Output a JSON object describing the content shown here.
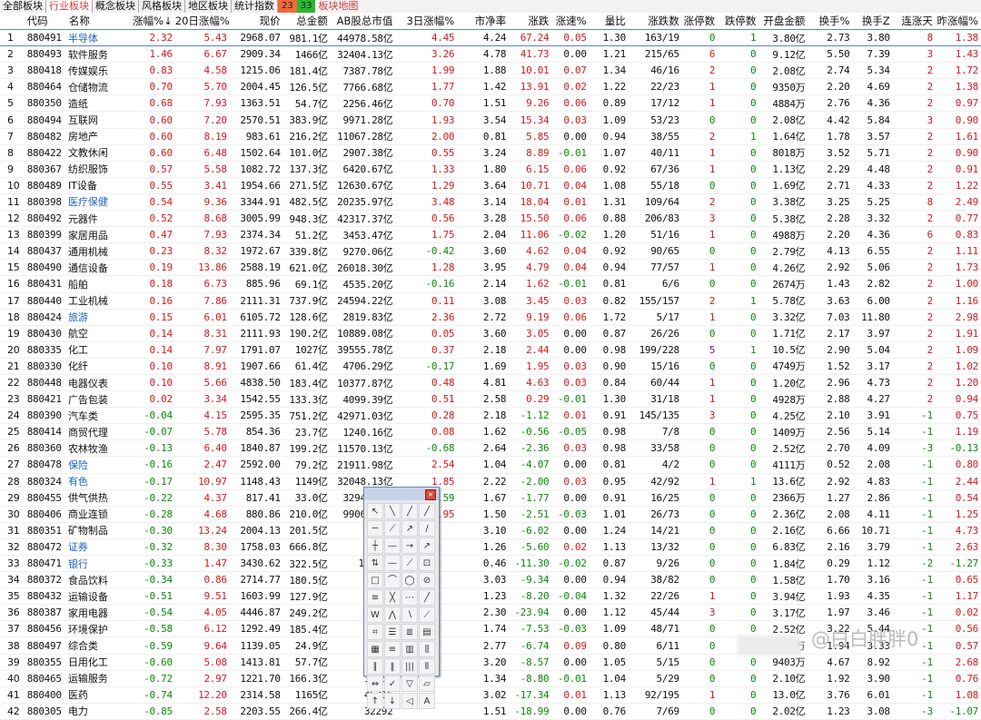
{
  "tabs": [
    {
      "label": "全部板块",
      "active": false
    },
    {
      "label": "行业板块",
      "active": true
    },
    {
      "label": "概念板块",
      "active": false
    },
    {
      "label": "风格板块",
      "active": false
    },
    {
      "label": "地区板块",
      "active": false
    },
    {
      "label": "统计指数",
      "active": false
    }
  ],
  "up_count": "23",
  "down_count": "33",
  "map_label": "板块地图",
  "headers": [
    "",
    "代码",
    "名称",
    "涨幅%↓",
    "20日涨幅%",
    "现价",
    "总金额",
    "AB股总市值",
    "3日涨幅%",
    "市净率",
    "涨跌",
    "涨速%",
    "量比",
    "涨跌数",
    "涨停数",
    "跌停数",
    "开盘金额",
    "换手%",
    "换手Z",
    "连涨天",
    "昨涨幅%"
  ],
  "rows": [
    [
      "1",
      "880491",
      "半导体",
      "2.32",
      "5.43",
      "2968.07",
      "981.1亿",
      "44978.58亿",
      "4.45",
      "4.24",
      "67.24",
      "0.05",
      "1.30",
      "163/19",
      "0",
      "1",
      "3.80亿",
      "2.73",
      "3.80",
      "8",
      "1.38"
    ],
    [
      "2",
      "880493",
      "软件服务",
      "1.46",
      "6.67",
      "2909.34",
      "1466亿",
      "32404.13亿",
      "3.26",
      "4.78",
      "41.73",
      "0.00",
      "1.21",
      "215/65",
      "6",
      "0",
      "9.12亿",
      "5.50",
      "7.39",
      "3",
      "1.43"
    ],
    [
      "3",
      "880418",
      "传媒娱乐",
      "0.83",
      "4.58",
      "1215.06",
      "181.4亿",
      "7387.78亿",
      "1.99",
      "1.88",
      "10.01",
      "0.07",
      "1.34",
      "46/16",
      "2",
      "0",
      "2.08亿",
      "2.74",
      "5.34",
      "2",
      "1.72"
    ],
    [
      "4",
      "880464",
      "仓储物流",
      "0.70",
      "5.70",
      "2004.45",
      "126.5亿",
      "7766.68亿",
      "1.77",
      "1.42",
      "13.91",
      "0.02",
      "1.22",
      "22/23",
      "1",
      "0",
      "9350万",
      "2.20",
      "4.69",
      "2",
      "1.38"
    ],
    [
      "5",
      "880350",
      "造纸",
      "0.68",
      "7.93",
      "1363.51",
      "54.7亿",
      "2256.46亿",
      "0.70",
      "1.51",
      "9.26",
      "0.06",
      "0.89",
      "17/12",
      "1",
      "0",
      "4884万",
      "2.76",
      "4.36",
      "2",
      "0.97"
    ],
    [
      "6",
      "880494",
      "互联网",
      "0.60",
      "7.20",
      "2570.51",
      "383.9亿",
      "9971.28亿",
      "1.93",
      "3.54",
      "15.34",
      "0.03",
      "1.09",
      "53/23",
      "0",
      "0",
      "2.08亿",
      "4.42",
      "5.84",
      "3",
      "0.90"
    ],
    [
      "7",
      "880482",
      "房地产",
      "0.60",
      "8.19",
      "983.61",
      "216.2亿",
      "11067.28亿",
      "2.00",
      "0.81",
      "5.85",
      "0.00",
      "0.94",
      "38/55",
      "2",
      "1",
      "1.64亿",
      "1.78",
      "3.57",
      "2",
      "1.61"
    ],
    [
      "8",
      "880422",
      "文教休闲",
      "0.60",
      "6.48",
      "1502.64",
      "101.0亿",
      "2907.38亿",
      "0.55",
      "3.24",
      "8.89",
      "-0.01",
      "1.07",
      "40/11",
      "1",
      "0",
      "8018万",
      "3.52",
      "5.71",
      "2",
      "0.90"
    ],
    [
      "9",
      "880367",
      "纺织服饰",
      "0.57",
      "5.58",
      "1082.72",
      "137.3亿",
      "6420.67亿",
      "1.33",
      "1.80",
      "6.15",
      "0.06",
      "0.92",
      "67/36",
      "1",
      "0",
      "1.13亿",
      "2.29",
      "4.48",
      "2",
      "0.91"
    ],
    [
      "10",
      "880489",
      "IT设备",
      "0.55",
      "3.41",
      "1954.66",
      "271.5亿",
      "12630.67亿",
      "1.29",
      "3.64",
      "10.71",
      "0.04",
      "1.08",
      "55/18",
      "0",
      "0",
      "1.69亿",
      "2.71",
      "4.33",
      "2",
      "1.22"
    ],
    [
      "11",
      "880398",
      "医疗保健",
      "0.54",
      "9.36",
      "3344.91",
      "482.5亿",
      "20235.97亿",
      "3.48",
      "3.14",
      "18.04",
      "0.01",
      "1.31",
      "109/64",
      "2",
      "0",
      "3.38亿",
      "3.25",
      "5.25",
      "8",
      "2.49"
    ],
    [
      "12",
      "880492",
      "元器件",
      "0.52",
      "8.68",
      "3005.99",
      "948.3亿",
      "42317.37亿",
      "0.56",
      "3.28",
      "15.50",
      "0.06",
      "0.88",
      "206/83",
      "3",
      "0",
      "5.38亿",
      "2.28",
      "3.32",
      "2",
      "0.77"
    ],
    [
      "13",
      "880399",
      "家居用品",
      "0.47",
      "7.93",
      "2374.34",
      "51.2亿",
      "3453.47亿",
      "1.75",
      "2.04",
      "11.06",
      "-0.02",
      "1.20",
      "51/16",
      "1",
      "0",
      "4988万",
      "2.20",
      "4.36",
      "6",
      "0.83"
    ],
    [
      "14",
      "880437",
      "通用机械",
      "0.23",
      "8.32",
      "1972.67",
      "339.8亿",
      "9270.06亿",
      "-0.42",
      "3.60",
      "4.62",
      "0.04",
      "0.92",
      "90/65",
      "0",
      "0",
      "2.79亿",
      "4.13",
      "6.55",
      "2",
      "1.11"
    ],
    [
      "15",
      "880490",
      "通信设备",
      "0.19",
      "13.86",
      "2588.19",
      "621.0亿",
      "26018.30亿",
      "1.28",
      "3.95",
      "4.79",
      "0.04",
      "0.94",
      "77/57",
      "1",
      "0",
      "4.26亿",
      "2.92",
      "5.06",
      "2",
      "1.73"
    ],
    [
      "16",
      "880431",
      "船舶",
      "0.18",
      "6.73",
      "885.96",
      "69.1亿",
      "4535.20亿",
      "-0.16",
      "2.14",
      "1.62",
      "-0.01",
      "0.81",
      "6/6",
      "0",
      "0",
      "2674万",
      "1.43",
      "2.82",
      "2",
      "1.00"
    ],
    [
      "17",
      "880440",
      "工业机械",
      "0.16",
      "7.86",
      "2111.31",
      "737.9亿",
      "24594.22亿",
      "0.11",
      "3.08",
      "3.45",
      "0.03",
      "0.82",
      "155/157",
      "2",
      "1",
      "5.78亿",
      "3.63",
      "6.00",
      "2",
      "1.16"
    ],
    [
      "18",
      "880424",
      "旅游",
      "0.15",
      "6.01",
      "6105.72",
      "128.6亿",
      "2819.83亿",
      "2.36",
      "2.72",
      "9.19",
      "0.06",
      "1.72",
      "5/17",
      "1",
      "0",
      "3.32亿",
      "7.03",
      "11.80",
      "2",
      "2.98"
    ],
    [
      "19",
      "880430",
      "航空",
      "0.14",
      "8.31",
      "2111.93",
      "190.2亿",
      "10889.08亿",
      "0.05",
      "3.60",
      "3.05",
      "0.00",
      "0.87",
      "26/26",
      "0",
      "0",
      "1.71亿",
      "2.17",
      "3.97",
      "2",
      "1.91"
    ],
    [
      "20",
      "880335",
      "化工",
      "0.14",
      "7.97",
      "1791.07",
      "1027亿",
      "39555.78亿",
      "0.37",
      "2.18",
      "2.44",
      "0.00",
      "0.98",
      "199/228",
      "5",
      "1",
      "10.5亿",
      "2.90",
      "5.04",
      "2",
      "1.09"
    ],
    [
      "21",
      "880330",
      "化纤",
      "0.10",
      "8.91",
      "1907.66",
      "61.4亿",
      "4706.29亿",
      "-0.17",
      "1.69",
      "1.95",
      "0.03",
      "0.90",
      "15/16",
      "0",
      "0",
      "4749万",
      "1.52",
      "3.17",
      "2",
      "1.02"
    ],
    [
      "22",
      "880448",
      "电器仪表",
      "0.10",
      "5.66",
      "4838.50",
      "183.4亿",
      "10377.87亿",
      "0.48",
      "4.81",
      "4.63",
      "0.03",
      "0.84",
      "60/44",
      "1",
      "0",
      "1.20亿",
      "2.96",
      "4.73",
      "2",
      "1.20"
    ],
    [
      "23",
      "880421",
      "广告包装",
      "0.02",
      "3.34",
      "1542.55",
      "133.3亿",
      "4099.39亿",
      "0.51",
      "2.58",
      "0.29",
      "-0.01",
      "1.30",
      "31/18",
      "1",
      "0",
      "4928万",
      "2.88",
      "4.27",
      "2",
      "0.94"
    ],
    [
      "24",
      "880390",
      "汽车类",
      "-0.04",
      "4.15",
      "2595.35",
      "751.2亿",
      "42971.03亿",
      "0.28",
      "2.18",
      "-1.12",
      "0.01",
      "0.91",
      "145/135",
      "3",
      "0",
      "4.25亿",
      "2.10",
      "3.91",
      "-1",
      "0.75"
    ],
    [
      "25",
      "880414",
      "商贸代理",
      "-0.07",
      "5.78",
      "854.36",
      "23.7亿",
      "1240.16亿",
      "0.08",
      "1.62",
      "-0.56",
      "-0.05",
      "0.98",
      "7/8",
      "0",
      "0",
      "1409万",
      "2.56",
      "5.14",
      "-1",
      "1.19"
    ],
    [
      "26",
      "880360",
      "农林牧渔",
      "-0.13",
      "6.40",
      "1840.87",
      "199.2亿",
      "11570.13亿",
      "-0.68",
      "2.64",
      "-2.36",
      "0.03",
      "0.98",
      "33/58",
      "0",
      "0",
      "2.52亿",
      "2.70",
      "4.09",
      "-3",
      "-0.13"
    ],
    [
      "27",
      "880478",
      "保险",
      "-0.16",
      "2.47",
      "2592.00",
      "79.2亿",
      "21911.98亿",
      "2.54",
      "1.04",
      "-4.07",
      "0.00",
      "0.81",
      "4/2",
      "0",
      "0",
      "4111万",
      "0.52",
      "2.08",
      "-1",
      "0.80"
    ],
    [
      "28",
      "880324",
      "有色",
      "-0.17",
      "10.97",
      "1148.43",
      "1149亿",
      "32048.13亿",
      "1.85",
      "2.22",
      "-2.00",
      "0.03",
      "0.95",
      "42/92",
      "1",
      "1",
      "13.6亿",
      "2.92",
      "4.83",
      "-1",
      "2.44"
    ],
    [
      "29",
      "880455",
      "供气供热",
      "-0.22",
      "4.37",
      "817.41",
      "33.0亿",
      "3294.26亿",
      "-0.59",
      "1.67",
      "-1.77",
      "0.00",
      "0.91",
      "16/25",
      "0",
      "0",
      "2366万",
      "1.27",
      "2.86",
      "-1",
      "0.54"
    ],
    [
      "30",
      "880406",
      "商业连锁",
      "-0.28",
      "4.68",
      "880.86",
      "210.0亿",
      "9906.76亿",
      "0.95",
      "1.50",
      "-2.51",
      "-0.03",
      "1.01",
      "26/73",
      "0",
      "0",
      "2.36亿",
      "2.08",
      "4.11",
      "-1",
      "1.25"
    ],
    [
      "31",
      "880351",
      "矿物制品",
      "-0.30",
      "13.24",
      "2004.13",
      "201.5亿",
      "3281",
      "",
      "3.10",
      "-6.02",
      "0.00",
      "1.24",
      "14/21",
      "0",
      "0",
      "2.16亿",
      "6.66",
      "10.71",
      "-1",
      "4.73"
    ],
    [
      "32",
      "880472",
      "证券",
      "-0.32",
      "8.30",
      "1758.03",
      "666.8亿",
      "36259",
      "",
      "1.26",
      "-5.60",
      "0.02",
      "1.13",
      "13/32",
      "0",
      "0",
      "6.83亿",
      "2.16",
      "3.79",
      "-1",
      "2.63"
    ],
    [
      "33",
      "880471",
      "银行",
      "-0.33",
      "1.47",
      "3430.62",
      "322.5亿",
      "110084",
      "",
      "0.46",
      "-11.30",
      "-0.02",
      "0.87",
      "9/26",
      "0",
      "0",
      "1.84亿",
      "0.29",
      "1.12",
      "-2",
      "-1.27"
    ],
    [
      "34",
      "880372",
      "食品饮料",
      "-0.34",
      "0.86",
      "2714.77",
      "180.5亿",
      "17309",
      "",
      "3.03",
      "-9.34",
      "0.00",
      "0.94",
      "38/82",
      "0",
      "0",
      "1.58亿",
      "1.70",
      "3.16",
      "-1",
      "0.65"
    ],
    [
      "35",
      "880432",
      "运输设备",
      "-0.51",
      "9.51",
      "1603.99",
      "127.9亿",
      "5432",
      "",
      "1.23",
      "-8.20",
      "-0.04",
      "1.32",
      "22/26",
      "1",
      "0",
      "3.94亿",
      "1.93",
      "4.35",
      "-1",
      "1.17"
    ],
    [
      "36",
      "880387",
      "家用电器",
      "-0.54",
      "4.05",
      "4446.87",
      "249.2亿",
      "18805",
      "",
      "2.30",
      "-23.94",
      "0.00",
      "1.12",
      "45/44",
      "3",
      "0",
      "3.17亿",
      "1.97",
      "3.46",
      "-1",
      "0.02"
    ],
    [
      "37",
      "880456",
      "环境保护",
      "-0.58",
      "6.12",
      "1292.49",
      "185.4亿",
      "7049",
      "",
      "1.74",
      "-7.53",
      "-0.03",
      "1.09",
      "48/71",
      "0",
      "0",
      "2.52亿",
      "3.22",
      "5.44",
      "-1",
      "0.56"
    ],
    [
      "38",
      "880497",
      "综合类",
      "-0.59",
      "9.64",
      "1139.05",
      "24.9亿",
      "1341",
      "",
      "2.77",
      "-6.74",
      "0.09",
      "0.80",
      "6/11",
      "0",
      "0",
      "2064万",
      "1.94",
      "3.33",
      "-1",
      "0.57"
    ],
    [
      "39",
      "880355",
      "日用化工",
      "-0.60",
      "5.08",
      "1413.81",
      "57.7亿",
      "1797",
      "",
      "3.20",
      "-8.57",
      "0.00",
      "1.05",
      "5/15",
      "0",
      "0",
      "9403万",
      "4.67",
      "8.92",
      "-1",
      "2.68"
    ],
    [
      "40",
      "880465",
      "运输服务",
      "-0.72",
      "2.97",
      "1221.70",
      "166.3亿",
      "13969",
      "",
      "1.34",
      "-8.80",
      "-0.01",
      "1.04",
      "5/29",
      "0",
      "0",
      "2.10亿",
      "1.92",
      "3.90",
      "-1",
      "0.76"
    ],
    [
      "41",
      "880400",
      "医药",
      "-0.74",
      "12.20",
      "2314.58",
      "1165亿",
      "45316",
      "",
      "3.02",
      "-17.34",
      "0.01",
      "1.13",
      "92/195",
      "1",
      "0",
      "13.0亿",
      "3.76",
      "6.01",
      "-1",
      "1.08"
    ],
    [
      "42",
      "880305",
      "电力",
      "-0.85",
      "2.58",
      "2203.55",
      "266.4亿",
      "32292",
      "",
      "1.51",
      "-18.99",
      "0.00",
      "0.76",
      "7/69",
      "0",
      "0",
      "2.02亿",
      "1.23",
      "3.08",
      "-3",
      "-1.07"
    ]
  ],
  "blue_names": [
    "半导体",
    "医疗保健",
    "旅游",
    "保险",
    "有色",
    "证券",
    "银行"
  ],
  "palette_tools": [
    "↖",
    "╲",
    "╱",
    "╱",
    "─",
    "⟋",
    "↗",
    "∕",
    "┼",
    "—",
    "→",
    "↗",
    "⇅",
    "—",
    "⟋",
    "⊡",
    "□",
    "⌒",
    "◯",
    "⊘",
    "≡",
    "╳",
    "⋯",
    "╱",
    "W",
    "⋀",
    "∖",
    "⟋",
    "⌗",
    "☰",
    "≣",
    "▤",
    "▦",
    "≡",
    "▥",
    "⫼",
    "∥",
    "‖",
    "|||",
    "⦀",
    "⇔",
    "✓",
    "▽",
    "▱",
    "↑",
    "↓",
    "◁",
    "A"
  ],
  "watermark": "@白白胖胖0"
}
